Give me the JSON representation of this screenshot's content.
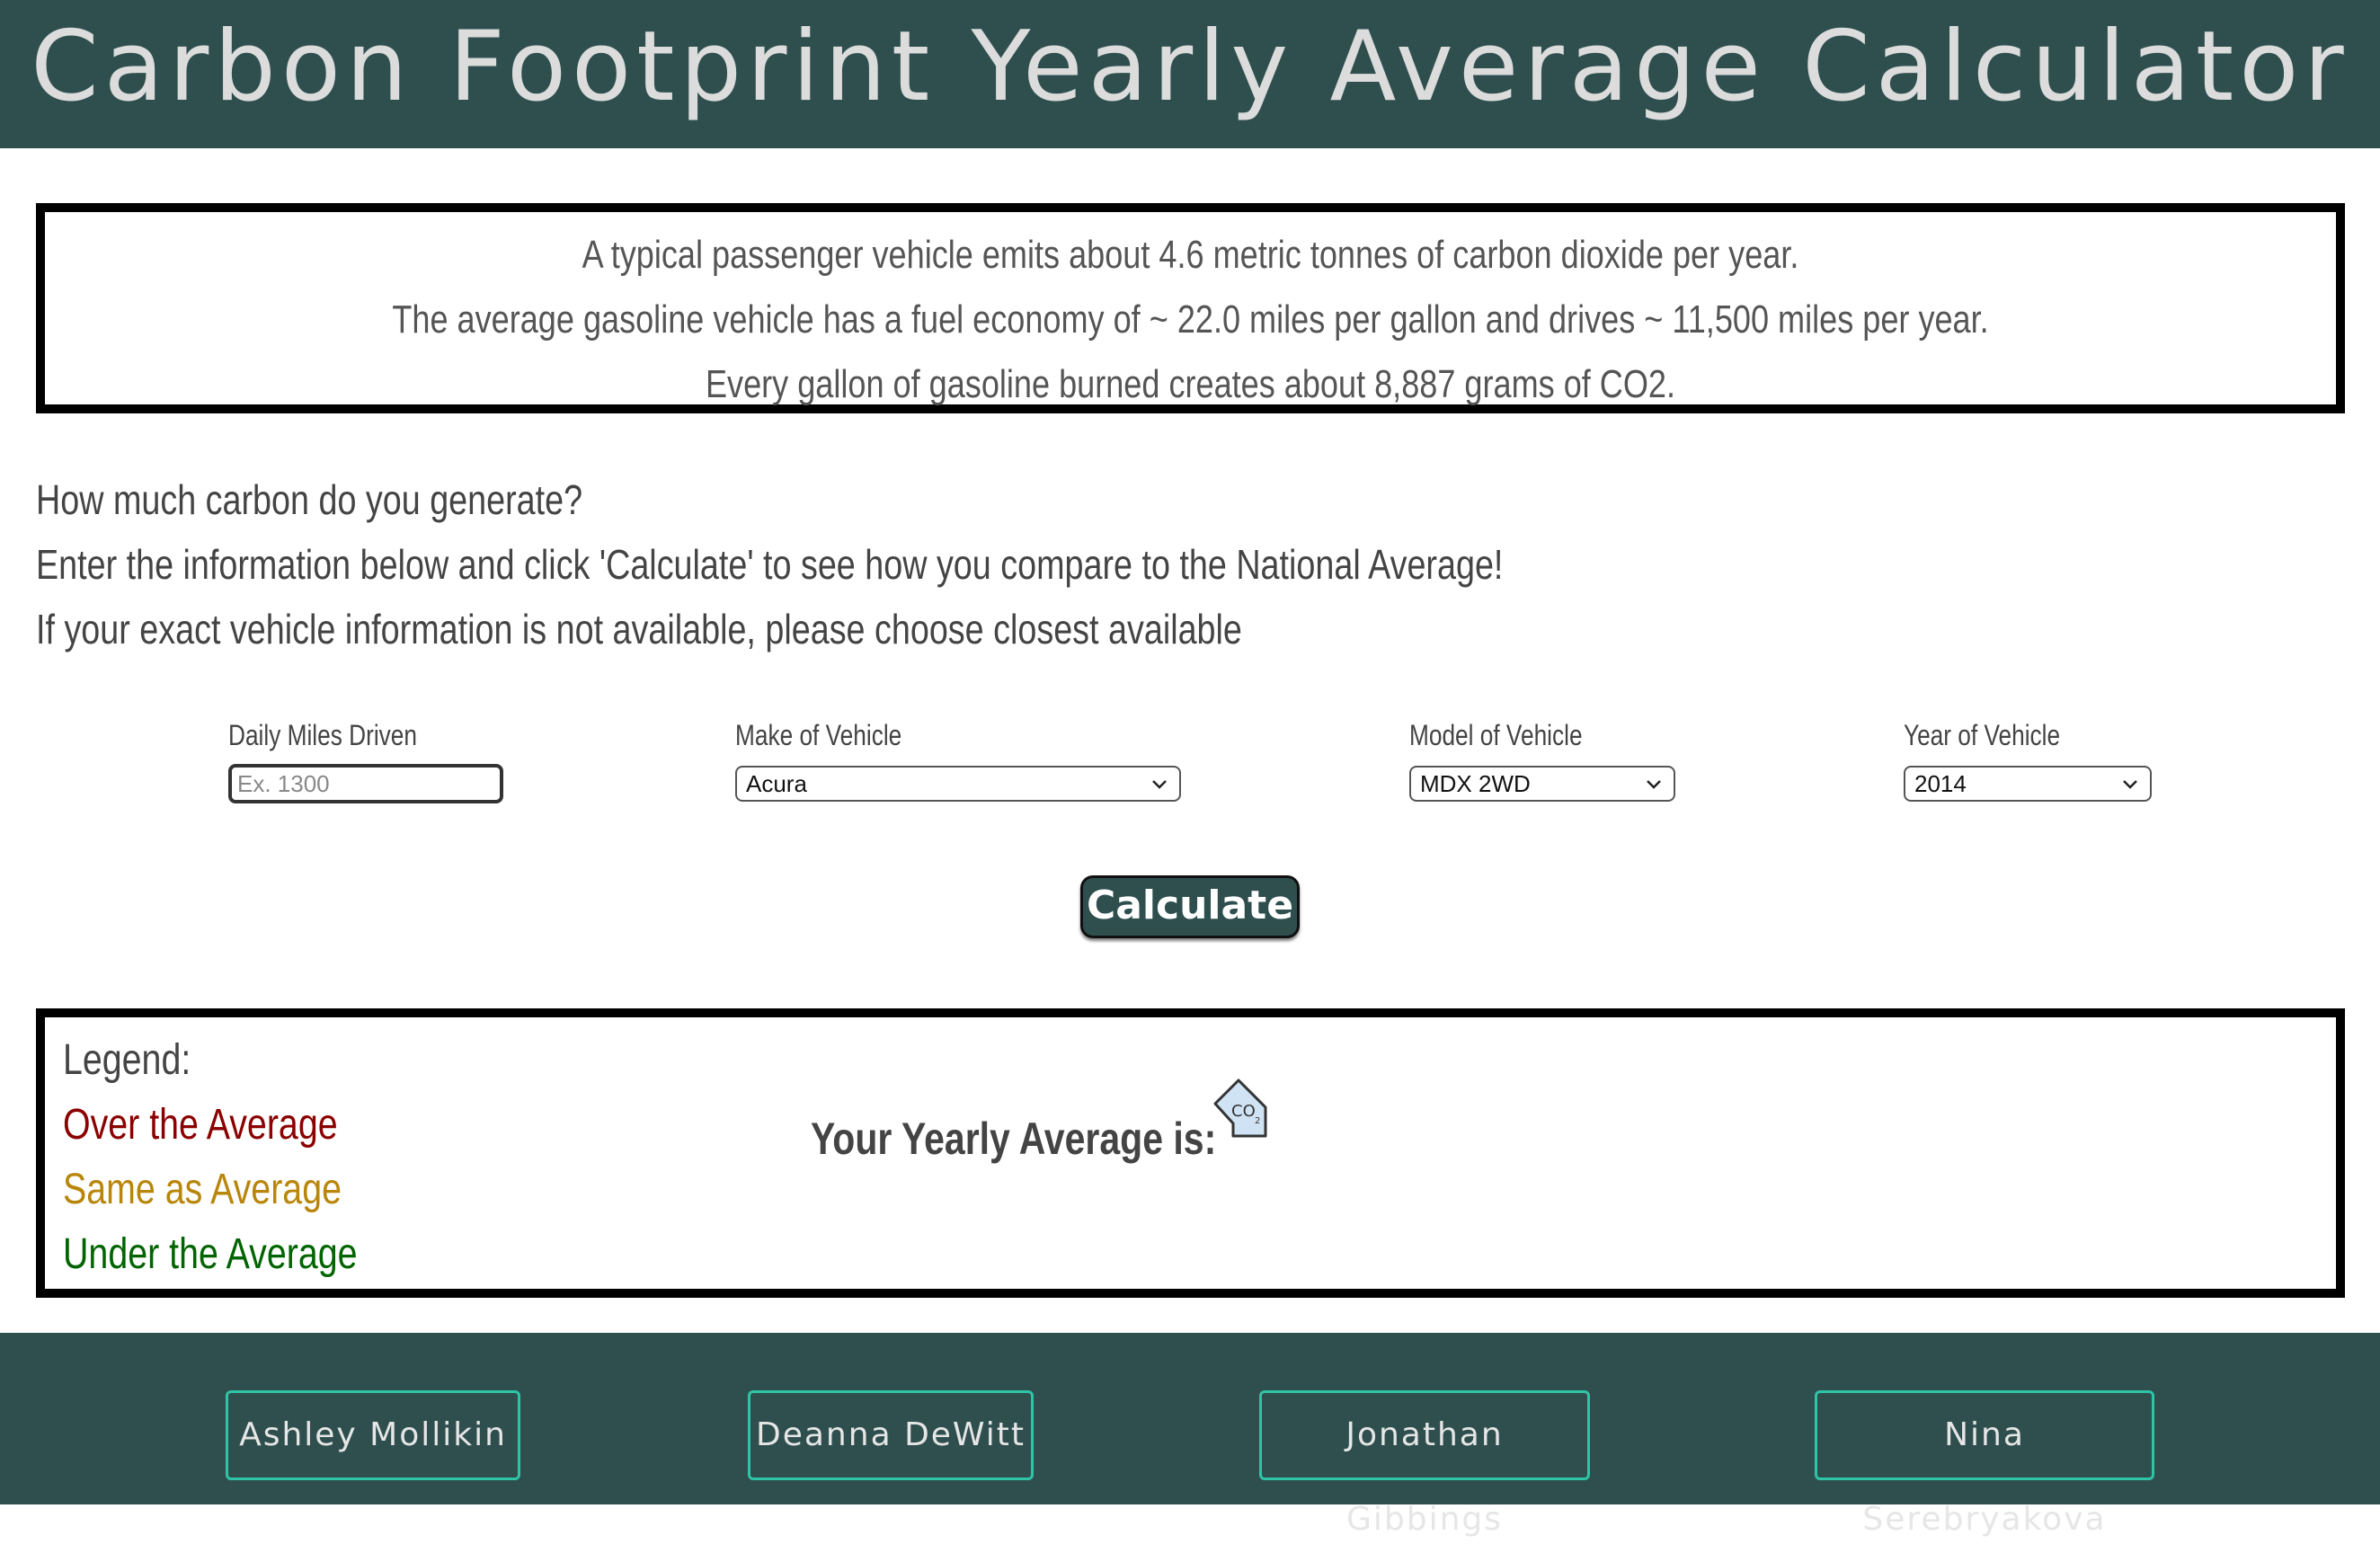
{
  "header": {
    "title": "Carbon Footprint Yearly Average Calculator"
  },
  "facts": [
    "A typical passenger vehicle emits about 4.6 metric tonnes of carbon dioxide per year.",
    "The average gasoline vehicle has a fuel economy of ~ 22.0 miles per gallon and drives ~ 11,500 miles per year.",
    "Every gallon of gasoline burned creates about 8,887 grams of CO2."
  ],
  "intro": [
    "How much carbon do you generate?",
    "Enter the information below and click 'Calculate' to see how you compare to the National Average!",
    "If your exact vehicle information is not available, please choose closest available"
  ],
  "form": {
    "miles": {
      "label": "Daily Miles Driven",
      "placeholder": "Ex. 1300",
      "value": ""
    },
    "make": {
      "label": "Make of Vehicle",
      "selected": "Acura"
    },
    "model": {
      "label": "Model of Vehicle",
      "selected": "MDX 2WD"
    },
    "year": {
      "label": "Year of Vehicle",
      "selected": "2014"
    },
    "calculate_label": "Calculate"
  },
  "legend": {
    "title": "Legend:",
    "over": "Over the Average",
    "same": "Same as Average",
    "under": "Under the Average",
    "colors": {
      "over": "#8b0000",
      "same": "#b8860b",
      "under": "#006400"
    }
  },
  "result": {
    "label": "Your Yearly Average is:",
    "icon": "co2-icon",
    "icon_text": "CO",
    "icon_sub": "2"
  },
  "footer": {
    "members": [
      "Ashley Mollikin",
      "Deanna DeWitt",
      "Jonathan Gibbings",
      "Nina Serebryakova"
    ],
    "accent": "#2ec4a6",
    "background": "#2f4f4f"
  }
}
